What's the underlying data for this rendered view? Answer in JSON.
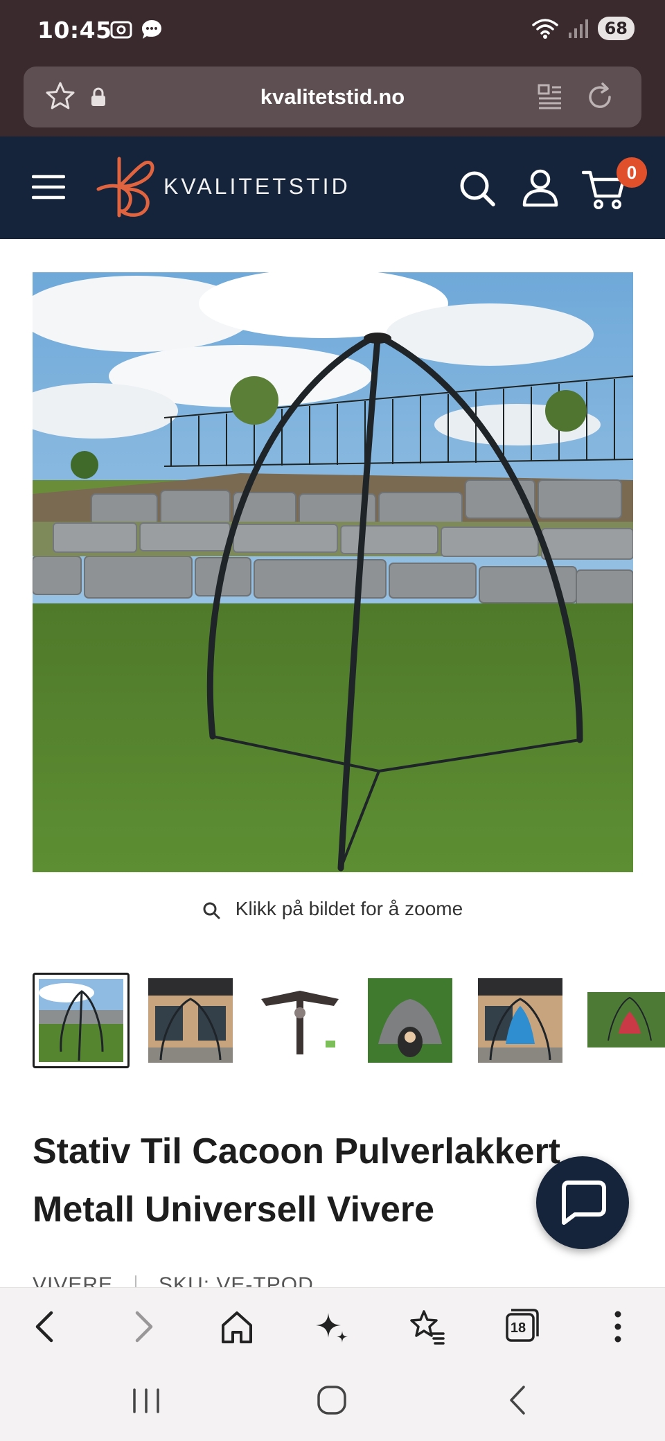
{
  "status_bar": {
    "time": "10:45",
    "battery": "68"
  },
  "browser": {
    "url": "kvalitetstid.no",
    "tab_count": "18"
  },
  "site": {
    "brand": "KVALITETSTID",
    "cart_count": "0"
  },
  "product": {
    "zoom_hint": "Klikk på bildet for å zoome",
    "title_line1": "Stativ Til Cacoon Pulverlakkert",
    "title_line2": "Metall Universell Vivere",
    "vendor": "VIVERE",
    "sku": "SKU: VE-TPOD"
  },
  "colors": {
    "header_bg": "#15243a",
    "status_bg": "#3a2a2e",
    "accent": "#e0502b"
  },
  "icons": [
    "camera-icon",
    "chat-bubble-icon",
    "wifi-icon",
    "signal-icon",
    "star-icon",
    "lock-icon",
    "reader-mode-icon",
    "reload-icon",
    "menu-icon",
    "search-icon",
    "account-icon",
    "cart-icon",
    "zoom-icon",
    "chat-icon",
    "back-icon",
    "forward-icon",
    "home-icon",
    "sparkle-icon",
    "bookmarks-icon",
    "tabs-icon",
    "more-icon",
    "recent-apps-icon",
    "home-nav-icon",
    "back-nav-icon"
  ]
}
